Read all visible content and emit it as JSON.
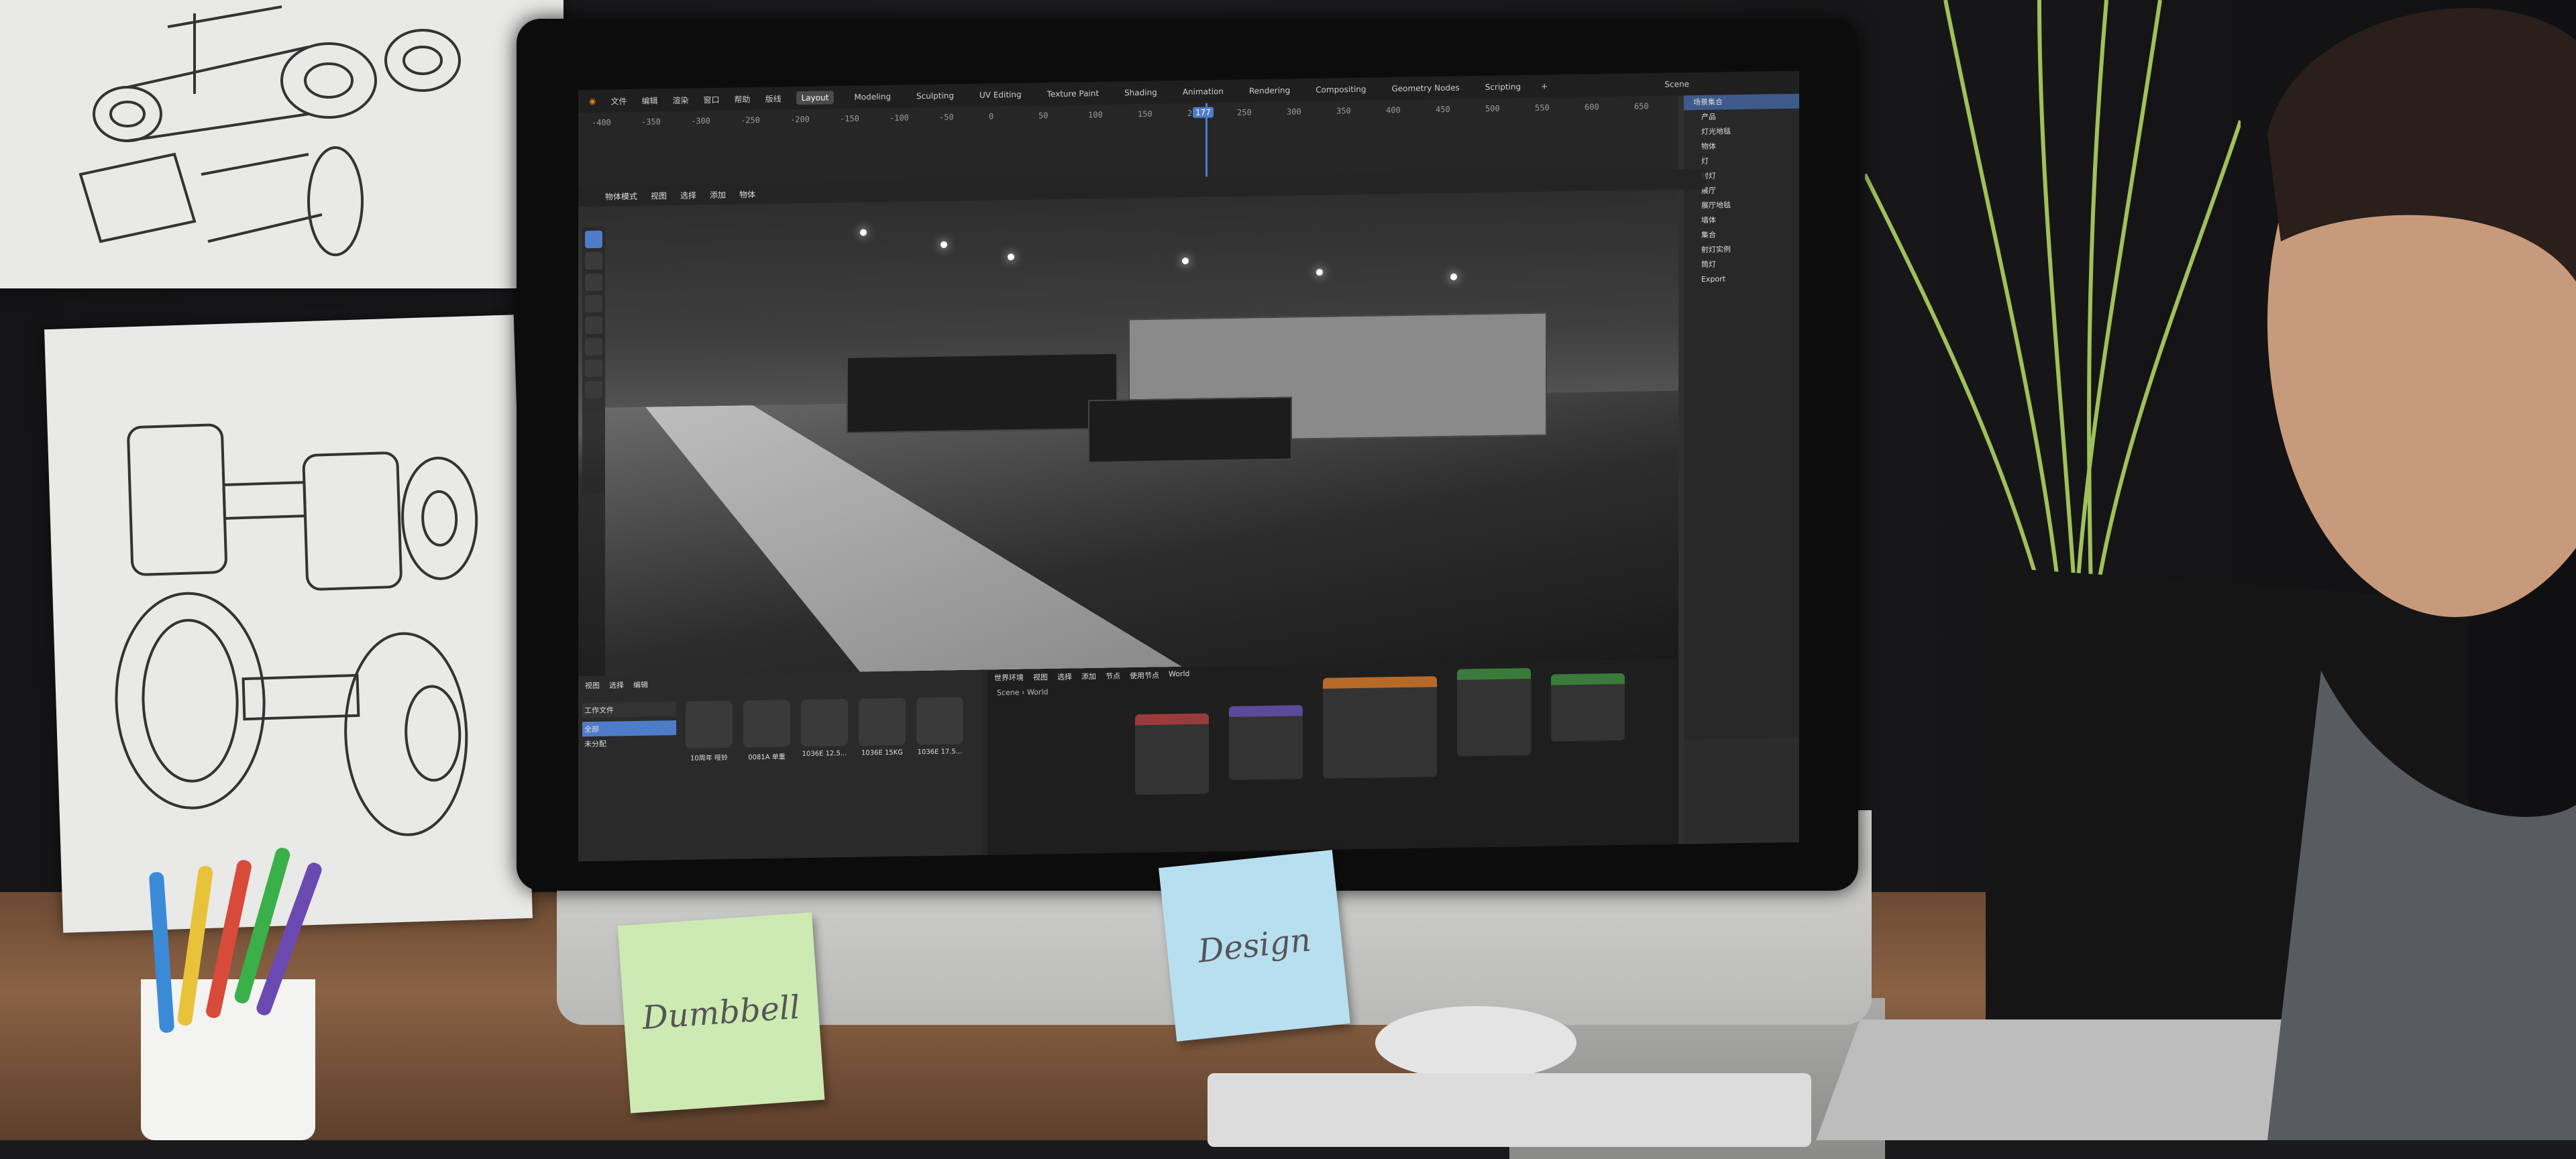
{
  "scene": {
    "note_left": "Dumbbell",
    "note_right": "Design"
  },
  "blender": {
    "menus": [
      "文件",
      "编辑",
      "渲染",
      "窗口",
      "帮助",
      "版线"
    ],
    "workspaces": [
      "Layout",
      "Modeling",
      "Sculpting",
      "UV Editing",
      "Texture Paint",
      "Shading",
      "Animation",
      "Rendering",
      "Compositing",
      "Geometry Nodes",
      "Scripting"
    ],
    "active_workspace": "Layout",
    "scene_name": "Scene",
    "current_frame": "177",
    "ruler_ticks": [
      "-400",
      "-350",
      "-300",
      "-250",
      "-200",
      "-150",
      "-100",
      "-50",
      "0",
      "50",
      "100",
      "150",
      "200",
      "250",
      "300",
      "350",
      "400",
      "450",
      "500",
      "550",
      "600",
      "650"
    ],
    "viewport_mode": "物体模式",
    "viewport_menus": [
      "视图",
      "选择",
      "添加",
      "物体"
    ],
    "outliner_title": "场景集合",
    "outliner_items": [
      "产品",
      "灯光地毯",
      "物体",
      "灯",
      "射灯",
      "展厅",
      "展厅地毯",
      "墙体",
      "集合",
      "射灯实例",
      "筒灯",
      "Export"
    ],
    "asset_menus": [
      "视图",
      "选择",
      "编辑"
    ],
    "asset_library": "工作文件",
    "asset_filter_all": "全部",
    "asset_unassigned": "未分配",
    "assets": [
      "10周年 哑铃",
      "0081A 单重",
      "1036E 12.5...",
      "1036E 15KG",
      "1036E 17.5..."
    ],
    "node_editor": {
      "world_label": "World",
      "breadcrumb_scene": "Scene",
      "breadcrumb_world": "World",
      "menus": [
        "视图",
        "选择",
        "添加",
        "节点"
      ],
      "use_nodes": "使用节点",
      "world_dropdown": "世界环境"
    },
    "colors": {
      "accent": "#4f7cc9",
      "note_green": "#cdeab2",
      "note_blue": "#b7dff0"
    }
  }
}
